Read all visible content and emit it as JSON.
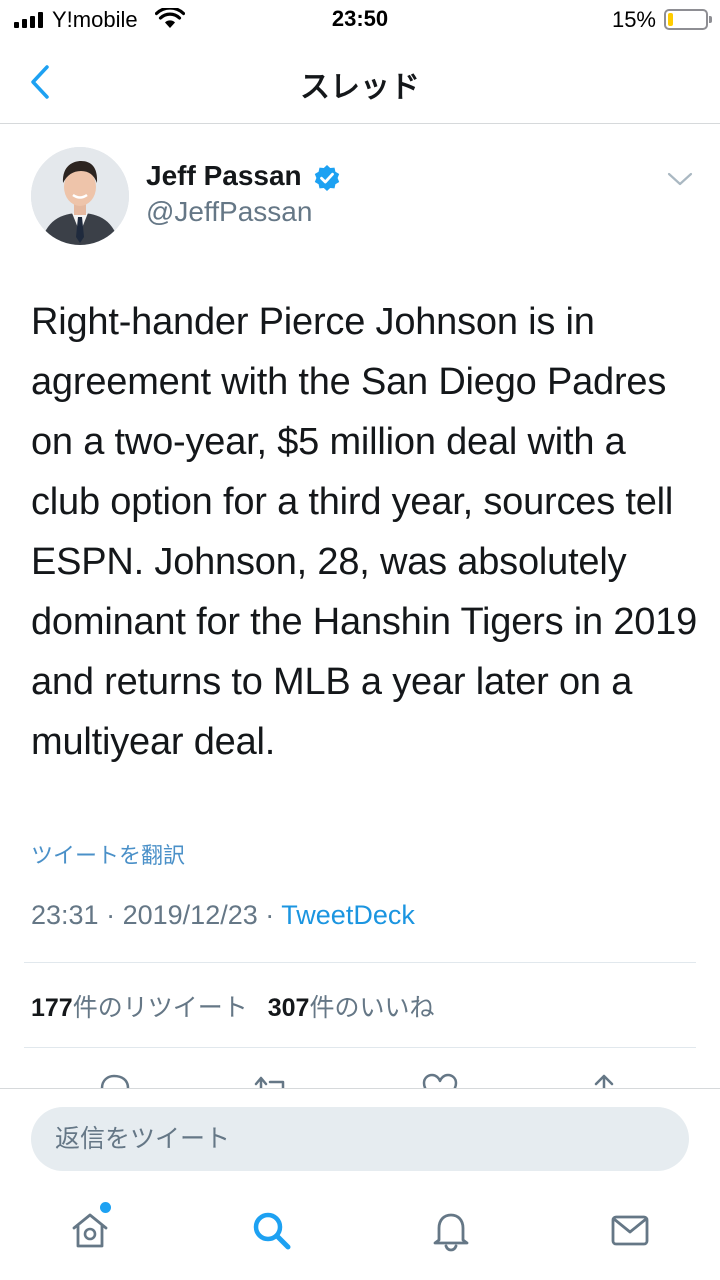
{
  "status_bar": {
    "carrier": "Y!mobile",
    "time": "23:50",
    "battery_percent_text": "15%",
    "battery_level": 0.15,
    "battery_color": "#ffcc00"
  },
  "nav": {
    "title": "スレッド",
    "back_icon": "chevron-left-icon"
  },
  "tweet": {
    "author_name": "Jeff Passan",
    "author_handle": "@JeffPassan",
    "verified": true,
    "text": "Right-hander Pierce Johnson is in agreement with the San Diego Padres on a two-year, $5 million deal with a club option for a third year, sources tell ESPN. Johnson, 28, was absolutely dominant for the Hanshin Tigers in 2019 and returns to MLB a year later on a multiyear deal.",
    "translate_label": "ツイートを翻訳",
    "time": "23:31",
    "date": "2019/12/23",
    "separator": "·",
    "source": "TweetDeck",
    "retweet_count": "177",
    "retweet_label": "件のリツイート",
    "like_count": "307",
    "like_label": "件のいいね"
  },
  "actions": [
    "reply-icon",
    "retweet-icon",
    "like-icon",
    "share-icon"
  ],
  "reply": {
    "placeholder": "返信をツイート"
  },
  "tabs": [
    "home-icon",
    "search-icon",
    "notifications-icon",
    "messages-icon"
  ],
  "colors": {
    "accent": "#1da1f2",
    "link": "#1b95e0",
    "secondary_text": "#657786",
    "primary_text": "#14171a"
  }
}
